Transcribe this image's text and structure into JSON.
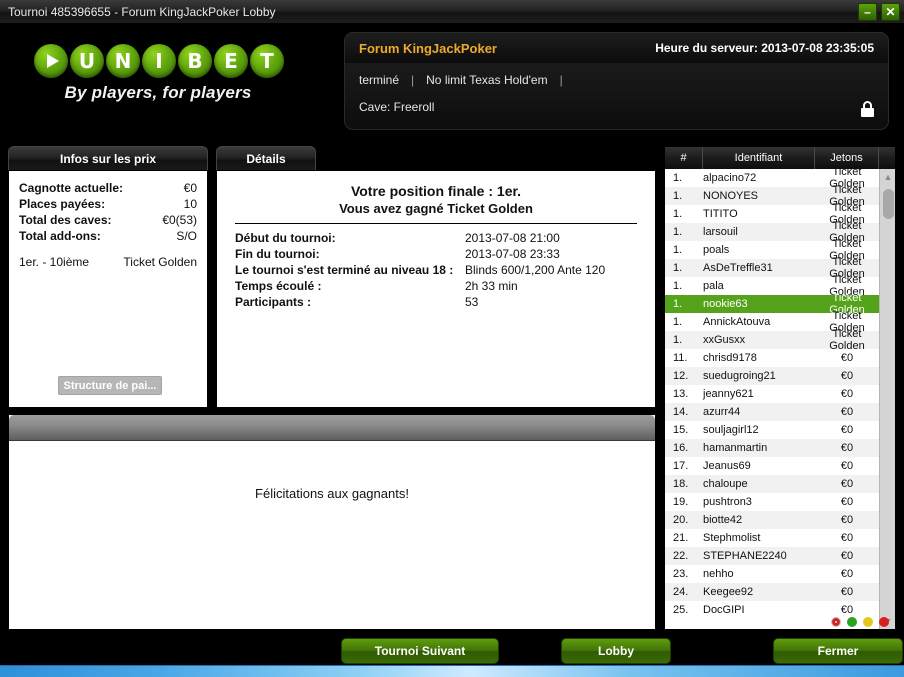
{
  "window": {
    "title": "Tournoi 485396655 - Forum KingJackPoker Lobby",
    "minimize_label": "–",
    "close_label": "✕"
  },
  "logo": {
    "letters": [
      "U",
      "N",
      "I",
      "B",
      "E",
      "T"
    ],
    "tagline": "By players, for players",
    "brand_color": "#63a80d"
  },
  "header": {
    "tournament_name": "Forum KingJackPoker",
    "server_time": "Heure du serveur: 2013-07-08 23:35:05",
    "status": "terminé",
    "game_type": "No limit Texas Hold'em",
    "extra": "",
    "buyin": "Cave: Freeroll",
    "lock_icon": "lock-icon",
    "title_color": "#eda92c"
  },
  "tabs": {
    "prizes": "Infos sur les prix",
    "details": "Détails"
  },
  "prizes": {
    "rows": [
      {
        "key": "Cagnotte actuelle:",
        "value": "€0"
      },
      {
        "key": "Places payées:",
        "value": "10"
      },
      {
        "key": "Total des caves:",
        "value": "€0(53)"
      },
      {
        "key": "Total add-ons:",
        "value": "S/O"
      }
    ],
    "payout_range": "1er. - 10ième",
    "payout_prize": "Ticket Golden",
    "structure_button": "Structure de pai..."
  },
  "details": {
    "final_position": "Votre position finale : 1er.",
    "won_line": "Vous avez gagné Ticket Golden",
    "rows": [
      {
        "key": "Début du tournoi:",
        "value": "2013-07-08 21:00"
      },
      {
        "key": "Fin du tournoi:",
        "value": "2013-07-08 23:33"
      },
      {
        "key": "Le tournoi s'est terminé au niveau 18 :",
        "value": "Blinds 600/1,200 Ante 120"
      },
      {
        "key": "Temps écoulé :",
        "value": "2h 33 min"
      },
      {
        "key": "Participants :",
        "value": "53"
      }
    ]
  },
  "message_panel": {
    "text": "Félicitations aux gagnants!"
  },
  "players": {
    "columns": {
      "rank": "#",
      "name": "Identifiant",
      "chips": "Jetons"
    },
    "selected_index": 7,
    "selected_color": "#55a31b",
    "rows": [
      {
        "rank": "1.",
        "name": "alpacino72",
        "chips": "Ticket Golden"
      },
      {
        "rank": "1.",
        "name": "NONOYES",
        "chips": "Ticket Golden"
      },
      {
        "rank": "1.",
        "name": "TITITO",
        "chips": "Ticket Golden"
      },
      {
        "rank": "1.",
        "name": "larsouil",
        "chips": "Ticket Golden"
      },
      {
        "rank": "1.",
        "name": "poals",
        "chips": "Ticket Golden"
      },
      {
        "rank": "1.",
        "name": "AsDeTreffle31",
        "chips": "Ticket Golden"
      },
      {
        "rank": "1.",
        "name": "pala",
        "chips": "Ticket Golden"
      },
      {
        "rank": "1.",
        "name": "nookie63",
        "chips": "Ticket Golden"
      },
      {
        "rank": "1.",
        "name": "AnnickAtouva",
        "chips": "Ticket Golden"
      },
      {
        "rank": "1.",
        "name": "xxGusxx",
        "chips": "Ticket Golden"
      },
      {
        "rank": "11.",
        "name": "chrisd9178",
        "chips": "€0"
      },
      {
        "rank": "12.",
        "name": "suedugroing21",
        "chips": "€0"
      },
      {
        "rank": "13.",
        "name": "jeanny621",
        "chips": "€0"
      },
      {
        "rank": "14.",
        "name": "azurr44",
        "chips": "€0"
      },
      {
        "rank": "15.",
        "name": "souljagirl12",
        "chips": "€0"
      },
      {
        "rank": "16.",
        "name": "hamanmartin",
        "chips": "€0"
      },
      {
        "rank": "17.",
        "name": "Jeanus69",
        "chips": "€0"
      },
      {
        "rank": "18.",
        "name": "chaloupe",
        "chips": "€0"
      },
      {
        "rank": "19.",
        "name": "pushtron3",
        "chips": "€0"
      },
      {
        "rank": "20.",
        "name": "biotte42",
        "chips": "€0"
      },
      {
        "rank": "21.",
        "name": "Stephmolist",
        "chips": "€0"
      },
      {
        "rank": "22.",
        "name": "STEPHANE2240",
        "chips": "€0"
      },
      {
        "rank": "23.",
        "name": "nehho",
        "chips": "€0"
      },
      {
        "rank": "24.",
        "name": "Keegee92",
        "chips": "€0"
      },
      {
        "rank": "25.",
        "name": "DocGIPI",
        "chips": "€0"
      }
    ],
    "scroll_up_icon": "▲",
    "scroll_down_icon": "▼",
    "status_dots": [
      {
        "name": "status-dot-offline",
        "color": "#ededed",
        "inner": "#d42020"
      },
      {
        "name": "status-dot-green",
        "color": "#2aa420",
        "inner": ""
      },
      {
        "name": "status-dot-yellow",
        "color": "#e5c81b",
        "inner": ""
      },
      {
        "name": "status-dot-red",
        "color": "#d42020",
        "inner": ""
      }
    ]
  },
  "actions": {
    "next_tournament": "Tournoi Suivant",
    "lobby": "Lobby",
    "close": "Fermer"
  }
}
